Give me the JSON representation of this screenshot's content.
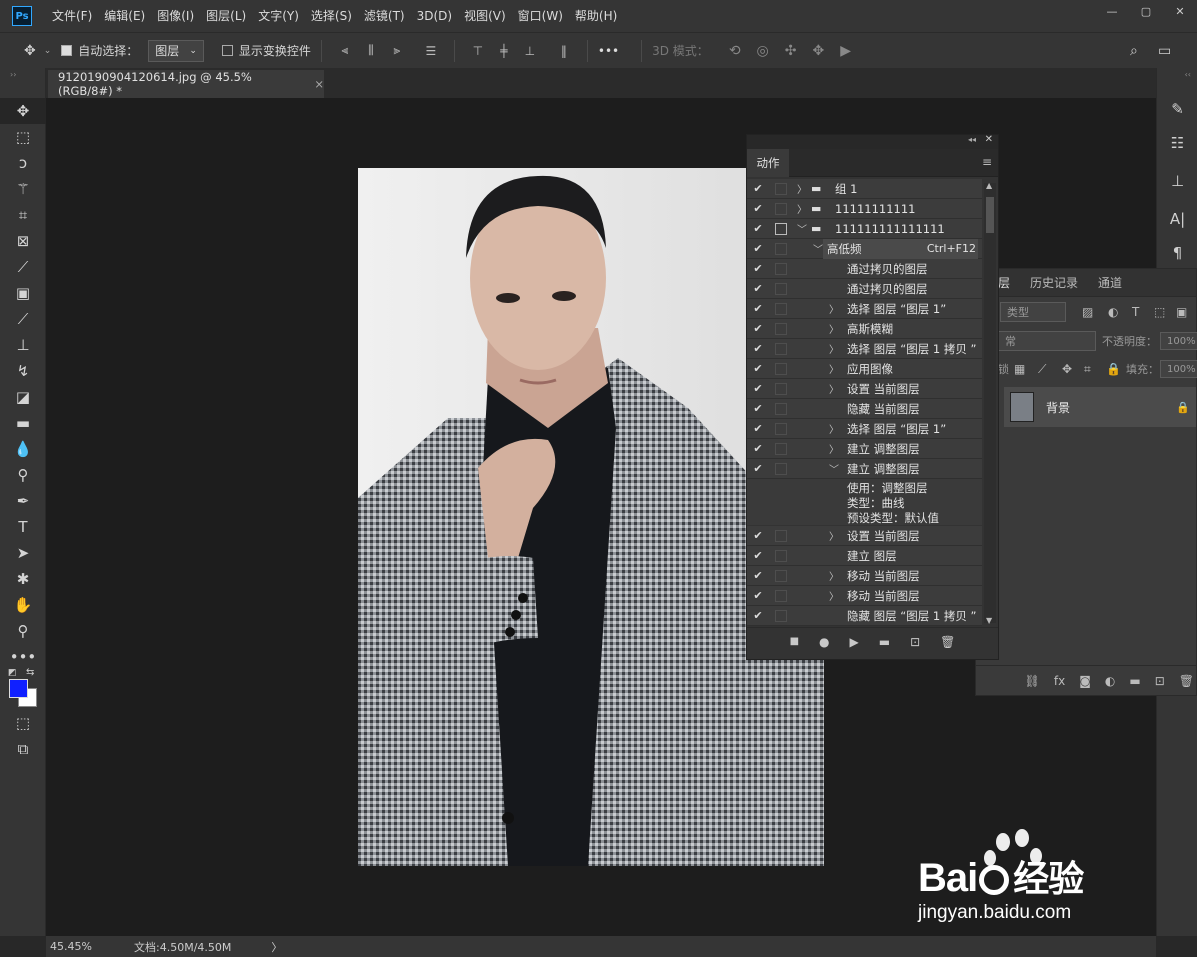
{
  "app": {
    "logo": "Ps"
  },
  "menu": [
    "文件(F)",
    "编辑(E)",
    "图像(I)",
    "图层(L)",
    "文字(Y)",
    "选择(S)",
    "滤镜(T)",
    "3D(D)",
    "视图(V)",
    "窗口(W)",
    "帮助(H)"
  ],
  "window_controls": {
    "minimize": "—",
    "restore": "▢",
    "close": "✕"
  },
  "options": {
    "auto_select_label": "自动选择：",
    "auto_select_checked": true,
    "auto_select_target": "图层",
    "show_transform_label": "显示变换控件",
    "show_transform_checked": false,
    "more": "•••",
    "mode_3d_label": "3D 模式："
  },
  "document": {
    "tab_title": "9120190904120614.jpg @ 45.5%(RGB/8#) *",
    "tab_close": "×"
  },
  "status": {
    "zoom": "45.45%",
    "doc_size": "文档:4.50M/4.50M",
    "arrow": "〉"
  },
  "actions_panel": {
    "title": "动作",
    "rows": [
      {
        "checked": true,
        "expand": "closed",
        "folder": true,
        "label": "组 1",
        "indent": 0
      },
      {
        "checked": true,
        "expand": "closed",
        "folder": true,
        "label": "11111111111",
        "indent": 0
      },
      {
        "checked": true,
        "expand": "open",
        "folder": true,
        "label": "111111111111111",
        "indent": 0,
        "dialog": true
      },
      {
        "checked": true,
        "expand": "open",
        "label": "高低频",
        "shortcut": "Ctrl+F12",
        "indent": 1,
        "highlight": true
      },
      {
        "checked": true,
        "expand": "none",
        "label": "通过拷贝的图层",
        "indent": 2
      },
      {
        "checked": true,
        "expand": "none",
        "label": "通过拷贝的图层",
        "indent": 2
      },
      {
        "checked": true,
        "expand": "closed",
        "label": "选择 图层 “图层 1”",
        "indent": 2
      },
      {
        "checked": true,
        "expand": "closed",
        "label": "高斯模糊",
        "indent": 2
      },
      {
        "checked": true,
        "expand": "closed",
        "label": "选择 图层 “图层 1 拷贝 ”",
        "indent": 2
      },
      {
        "checked": true,
        "expand": "closed",
        "label": "应用图像",
        "indent": 2
      },
      {
        "checked": true,
        "expand": "closed",
        "label": "设置 当前图层",
        "indent": 2
      },
      {
        "checked": true,
        "expand": "none",
        "label": "隐藏 当前图层",
        "indent": 2
      },
      {
        "checked": true,
        "expand": "closed",
        "label": "选择 图层 “图层 1”",
        "indent": 2
      },
      {
        "checked": true,
        "expand": "closed",
        "label": "建立 调整图层",
        "indent": 2
      },
      {
        "checked": true,
        "expand": "open",
        "label": "建立 调整图层",
        "indent": 2
      }
    ],
    "sub_lines": [
      "使用：调整图层",
      "类型：曲线",
      "预设类型：默认值"
    ],
    "rows_after": [
      {
        "checked": true,
        "expand": "closed",
        "label": "设置 当前图层",
        "indent": 2
      },
      {
        "checked": true,
        "expand": "none",
        "label": "建立 图层",
        "indent": 2
      },
      {
        "checked": true,
        "expand": "closed",
        "label": "移动 当前图层",
        "indent": 2
      },
      {
        "checked": true,
        "expand": "closed",
        "label": "移动 当前图层",
        "indent": 2
      },
      {
        "checked": true,
        "expand": "none",
        "label": "隐藏 图层 “图层 1 拷贝 ”",
        "indent": 2
      }
    ]
  },
  "layers_panel": {
    "tabs": [
      "层",
      "历史记录",
      "通道"
    ],
    "filter_kind": "类型",
    "blend_mode": "常",
    "opacity_label": "不透明度：",
    "opacity_value": "100%",
    "lock_label": "锁定：",
    "fill_label": "填充：",
    "fill_value": "100%",
    "layer_name": "背景"
  },
  "watermark": {
    "brand": "Bai",
    "brand2": "经验",
    "url": "jingyan.baidu.com"
  }
}
